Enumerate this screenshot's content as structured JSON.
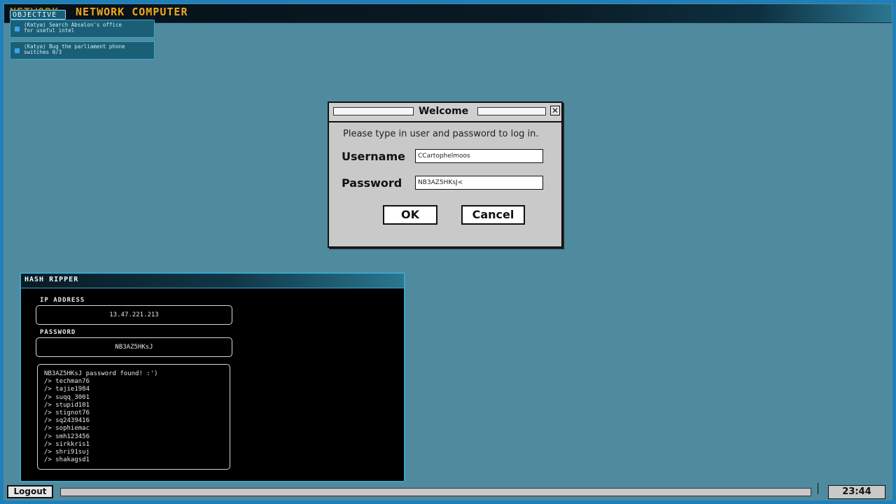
{
  "topbar": {
    "title": "NETWORK COMPUTER"
  },
  "objectives": {
    "tag": "OBJECTIVE",
    "items": [
      {
        "text": "(Katya) Search Absalon's office\nfor useful intel"
      },
      {
        "text": "(Katya) Bug the parliament phone\nswitches 0/3"
      }
    ]
  },
  "dialog": {
    "title": "Welcome",
    "message": "Please type in user and password to log in.",
    "username_label": "Username",
    "username_value": "CCartophelmoos",
    "password_label": "Password",
    "password_value": "NB3AZ5HKsJ<",
    "ok_label": "OK",
    "cancel_label": "Cancel"
  },
  "hash_ripper": {
    "title": "HASH RIPPER",
    "ip_label": "IP ADDRESS",
    "ip_value": "13.47.221.213",
    "password_label": "PASSWORD",
    "password_value": "NB3AZ5HKsJ",
    "log": [
      "NB3AZ5HKsJ password found! :')",
      "/> techman76",
      "/> tajie1984",
      "/> suqq_3001",
      "/> stupid101",
      "/> stignot76",
      "/> sq2439416",
      "/> sophiemac",
      "/> smh123456",
      "/> sirkkris1",
      "/> shri91suj",
      "/> shakagsd1"
    ]
  },
  "bottombar": {
    "logout_label": "Logout",
    "clock": "23:44"
  },
  "colors": {
    "desktop": "#4f8a9f",
    "accent": "#f1a81e",
    "frame": "#1f7fb8",
    "panel_border": "#3ba6c9"
  }
}
